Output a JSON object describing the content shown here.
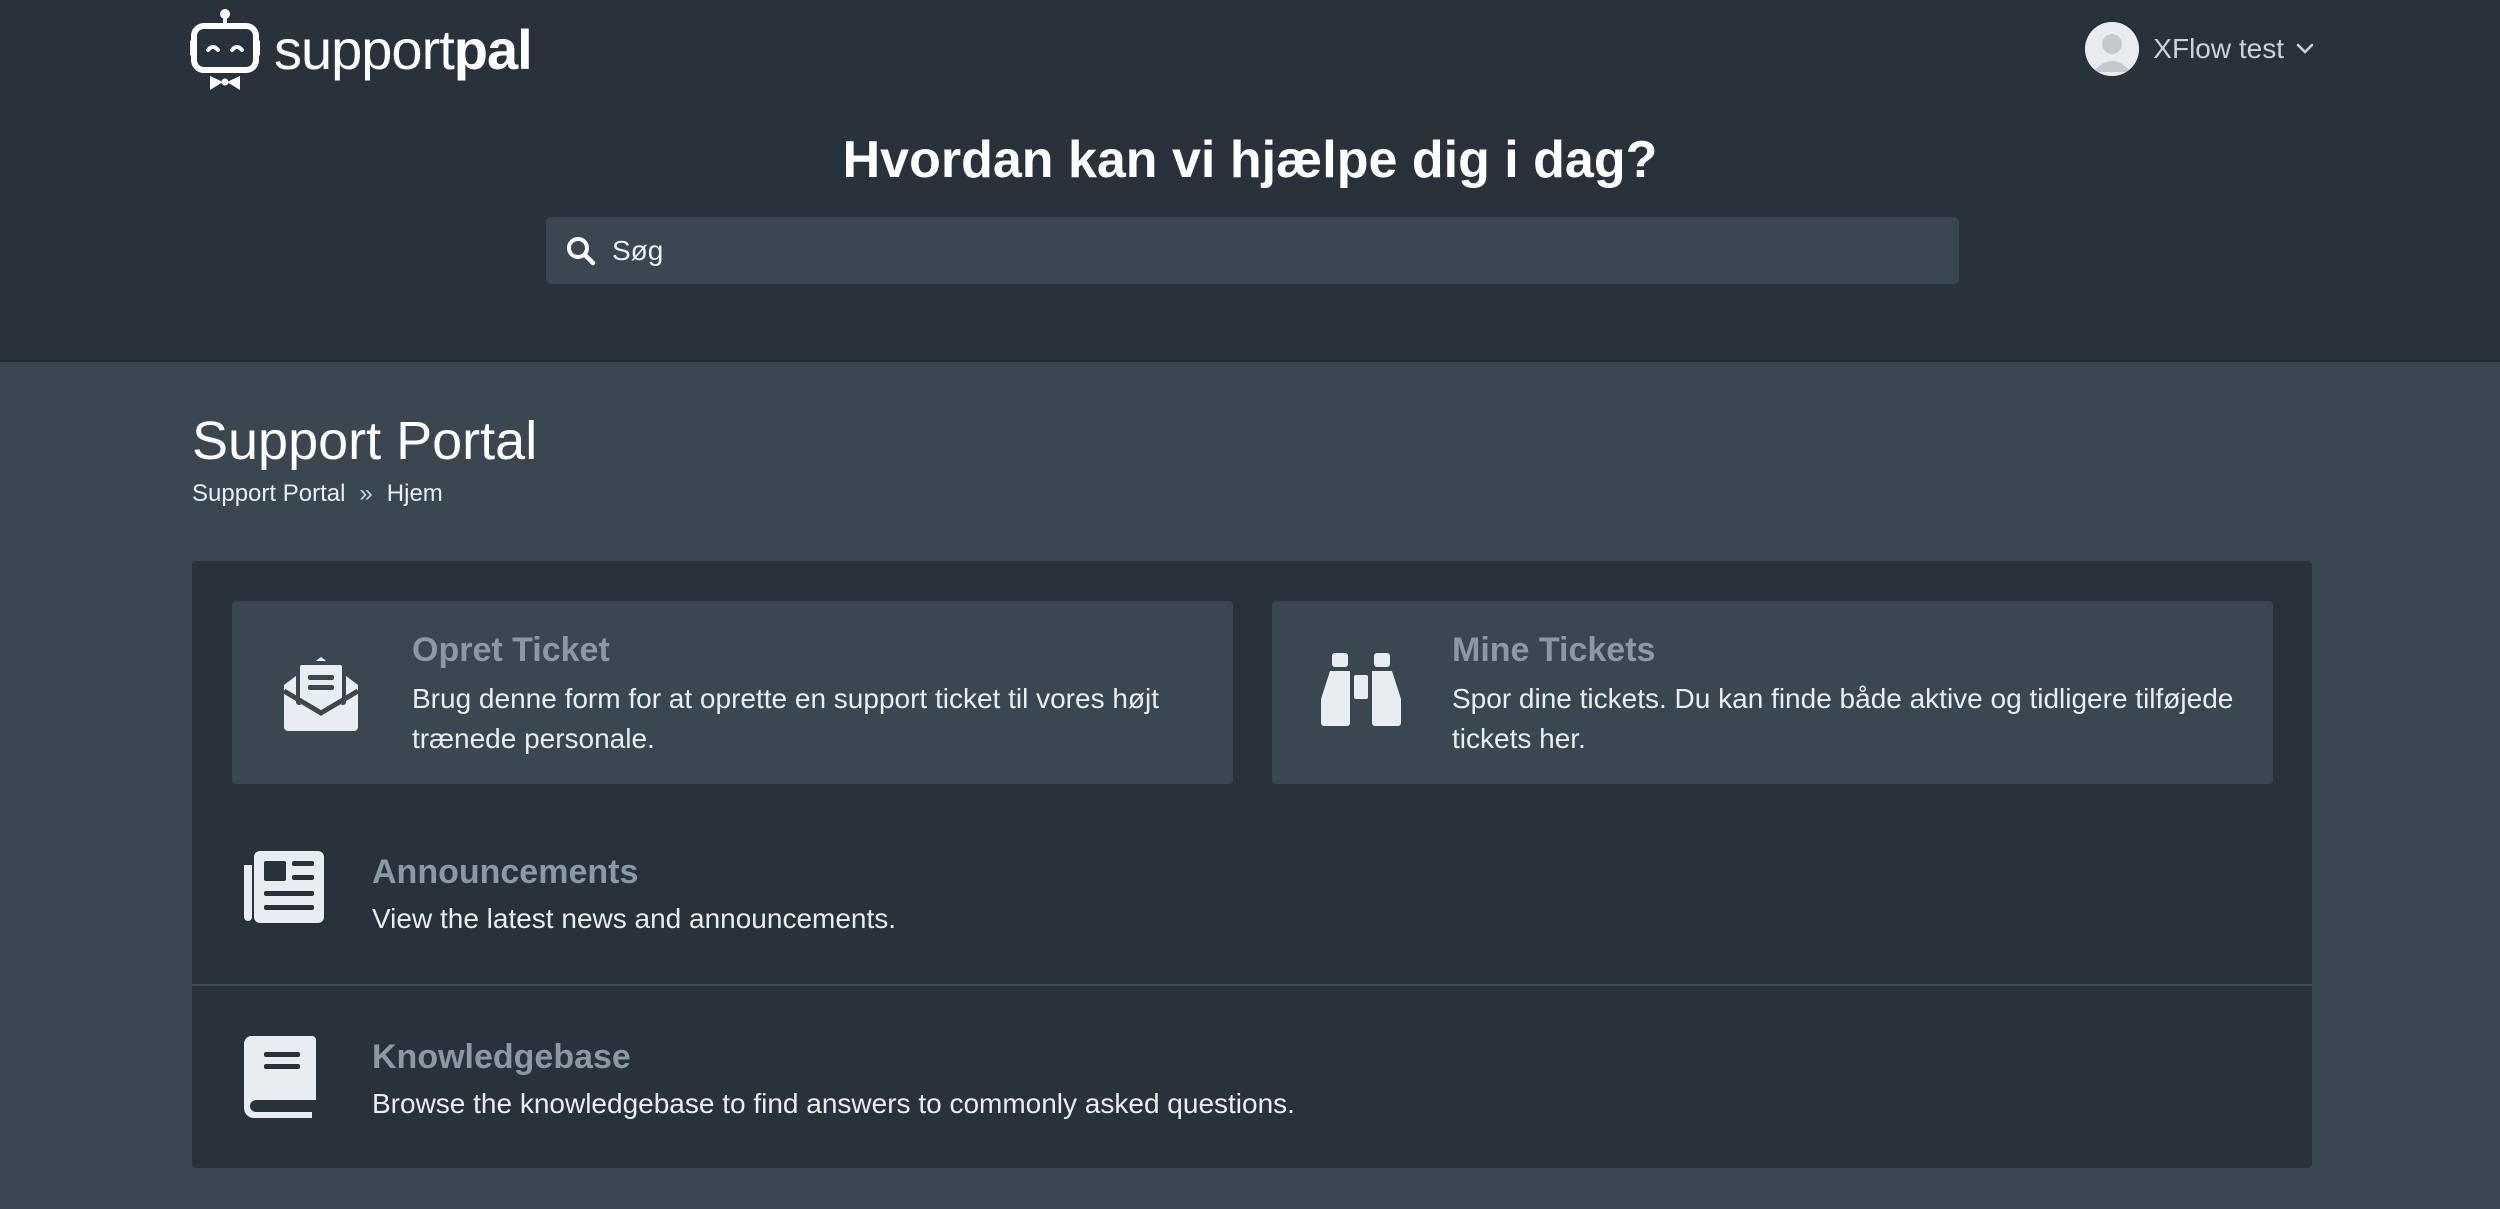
{
  "brand": {
    "name_light": "support",
    "name_bold": "pal"
  },
  "user": {
    "name": "XFlow test"
  },
  "hero": {
    "title": "Hvordan kan vi hjælpe dig i dag?"
  },
  "search": {
    "placeholder": "Søg"
  },
  "page": {
    "title": "Support Portal"
  },
  "breadcrumb": {
    "items": [
      "Support Portal",
      "Hjem"
    ],
    "separator": "»"
  },
  "cards": [
    {
      "title": "Opret Ticket",
      "description": "Brug denne form for at oprette en support ticket til vores højt trænede personale.",
      "icon": "envelope-open-text-icon"
    },
    {
      "title": "Mine Tickets",
      "description": "Spor dine tickets. Du kan finde både aktive og tidligere tilføjede tickets her.",
      "icon": "binoculars-icon"
    }
  ],
  "sections": [
    {
      "title": "Announcements",
      "description": "View the latest news and announcements.",
      "icon": "newspaper-icon"
    },
    {
      "title": "Knowledgebase",
      "description": "Browse the knowledgebase to find answers to commonly asked questions.",
      "icon": "book-icon"
    }
  ],
  "colors": {
    "header_bg": "#29323b",
    "page_bg": "#3a4750",
    "card_bg": "#3a4750",
    "title_muted": "#8a99a5",
    "text": "#e8edf1"
  }
}
